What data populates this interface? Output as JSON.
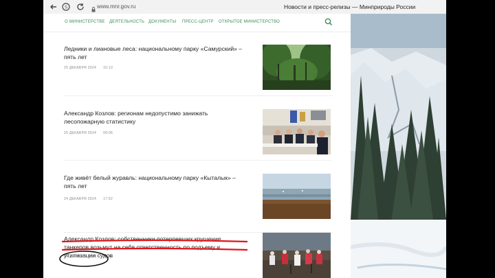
{
  "browser": {
    "url": "www.mnr.gov.ru",
    "window_title": "Новости и пресс-релизы — Минприроды России"
  },
  "nav": {
    "items": [
      "О МИНИСТЕРСТВЕ",
      "ДЕЯТЕЛЬНОСТЬ",
      "ДОКУМЕНТЫ",
      "ПРЕСС-ЦЕНТР",
      "ОТКРЫТОЕ МИНИСТЕРСТВО"
    ]
  },
  "articles": [
    {
      "title": "Ледники и лиановые леса: национальному парку «Самурский» – пять лет",
      "date": "25 ДЕКАБРЯ 2024",
      "time": "15:13"
    },
    {
      "title": "Александр Козлов: регионам недопустимо занижать лесопожарную статистику",
      "date": "25 ДЕКАБРЯ 2024",
      "time": "09:06"
    },
    {
      "title": "Где живёт белый журавль: национальному парку «Кыталык» – пять лет",
      "date": "24 ДЕКАБРЯ 2024",
      "time": "17:52"
    },
    {
      "title": "Александр Козлов: собственники потерпевших крушение танкеров возьмут на себя ответственность по подъему и утилизации судов",
      "date": "24 ДЕКАБРЯ 2024",
      "time": "09:44"
    }
  ],
  "colors": {
    "nav_green": "#3a8d57",
    "annotation_red": "#e0151b",
    "annotation_ellipse": "#111111"
  },
  "icons": [
    "back-arrow-icon",
    "forward-arrow-icon",
    "yandex-browser-icon",
    "reload-icon",
    "lock-icon",
    "search-icon"
  ]
}
